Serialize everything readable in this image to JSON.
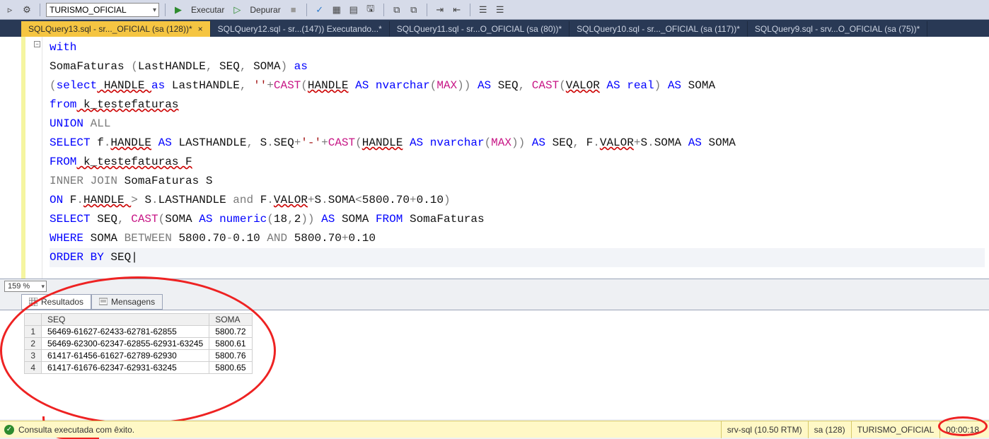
{
  "toolbar": {
    "combo_db": "TURISMO_OFICIAL",
    "execute_label": "Executar",
    "debug_label": "Depurar"
  },
  "tabs": [
    {
      "label": "SQLQuery13.sql - sr..._OFICIAL (sa (128))*",
      "active": true
    },
    {
      "label": "SQLQuery12.sql - sr...(147)) Executando...*",
      "active": false
    },
    {
      "label": "SQLQuery11.sql - sr...O_OFICIAL (sa (80))*",
      "active": false
    },
    {
      "label": "SQLQuery10.sql - sr..._OFICIAL (sa (117))*",
      "active": false
    },
    {
      "label": "SQLQuery9.sql - srv...O_OFICIAL (sa (75))*",
      "active": false
    }
  ],
  "code": {
    "l1": "with",
    "l2a": "SomaFaturas ",
    "l2b": "(",
    "l2c": "LastHANDLE",
    "l2d": ", ",
    "l2e": "SEQ",
    "l2f": ", ",
    "l2g": "SOMA",
    "l2h": ") ",
    "l2i": "as",
    "l3a": "(",
    "l3b": "select",
    "l3c": " HANDLE ",
    "l3d": "as",
    "l3e": " LastHANDLE",
    "l3f": ", ",
    "l3g": "''",
    "l3h": "+",
    "l3i": "CAST",
    "l3j": "(",
    "l3k": "HANDLE",
    "l3l": " AS ",
    "l3m": "nvarchar",
    "l3n": "(",
    "l3o": "MAX",
    "l3p": ")) ",
    "l3q": "AS ",
    "l3r": "SEQ",
    "l3s": ", ",
    "l3t": "CAST",
    "l3u": "(",
    "l3v": "VALOR",
    "l3w": " AS ",
    "l3x": "real",
    "l3y": ") ",
    "l3z": "AS ",
    "l3aa": "SOMA",
    "l4a": "from",
    "l4b": " k_testefaturas",
    "l5a": "UNION ",
    "l5b": "ALL",
    "l6a": "SELECT",
    "l6b": " f",
    "l6c": ".",
    "l6d": "HANDLE",
    "l6e": " AS ",
    "l6f": "LASTHANDLE",
    "l6g": ", ",
    "l6h": "S",
    "l6i": ".",
    "l6j": "SEQ",
    "l6k": "+",
    "l6l": "'-'",
    "l6m": "+",
    "l6n": "CAST",
    "l6o": "(",
    "l6p": "HANDLE",
    "l6q": " AS ",
    "l6r": "nvarchar",
    "l6s": "(",
    "l6t": "MAX",
    "l6u": ")) ",
    "l6v": "AS ",
    "l6w": "SEQ",
    "l6x": ", ",
    "l6y": "F",
    "l6z": ".",
    "l6aa": "VALOR",
    "l6ab": "+",
    "l6ac": "S",
    "l6ad": ".",
    "l6ae": "SOMA",
    "l6af": " AS ",
    "l6ag": "SOMA",
    "l7a": "FROM",
    "l7b": " k_testefaturas F",
    "l8a": "INNER",
    "l8b": " JOIN",
    "l8c": " SomaFaturas S",
    "l9a": "ON",
    "l9b": " F",
    "l9c": ".",
    "l9d": "HANDLE ",
    "l9e": ">",
    "l9f": " S",
    "l9g": ".",
    "l9h": "LASTHANDLE ",
    "l9i": "and",
    "l9j": " F",
    "l9k": ".",
    "l9l": "VALOR",
    "l9m": "+",
    "l9n": "S",
    "l9o": ".",
    "l9p": "SOMA",
    "l9q": "<",
    "l9r": "5800.70",
    "l9s": "+",
    "l9t": "0.10",
    "l9u": ")",
    "l10a": "SELECT",
    "l10b": " SEQ",
    "l10c": ", ",
    "l10d": "CAST",
    "l10e": "(",
    "l10f": "SOMA ",
    "l10g": "AS ",
    "l10h": "numeric",
    "l10i": "(",
    "l10j": "18",
    "l10k": ",",
    "l10l": "2",
    "l10m": ")) ",
    "l10n": "AS ",
    "l10o": "SOMA ",
    "l10p": "FROM",
    "l10q": " SomaFaturas",
    "l11a": "WHERE",
    "l11b": " SOMA ",
    "l11c": "BETWEEN",
    "l11d": " 5800.70",
    "l11e": "-",
    "l11f": "0.10 ",
    "l11g": "AND",
    "l11h": " 5800.70",
    "l11i": "+",
    "l11j": "0.10",
    "l12a": "ORDER",
    "l12b": " BY",
    "l12c": " SEQ"
  },
  "zoom": "159 %",
  "panel_tabs": {
    "results": "Resultados",
    "messages": "Mensagens"
  },
  "grid": {
    "headers": [
      "SEQ",
      "SOMA"
    ],
    "rows": [
      {
        "n": "1",
        "seq": "56469-61627-62433-62781-62855",
        "soma": "5800.72"
      },
      {
        "n": "2",
        "seq": "56469-62300-62347-62855-62931-63245",
        "soma": "5800.61"
      },
      {
        "n": "3",
        "seq": "61417-61456-61627-62789-62930",
        "soma": "5800.76"
      },
      {
        "n": "4",
        "seq": "61417-61676-62347-62931-63245",
        "soma": "5800.65"
      }
    ]
  },
  "status": {
    "message": "Consulta executada com êxito.",
    "server": "srv-sql (10.50 RTM)",
    "login": "sa (128)",
    "db": "TURISMO_OFICIAL",
    "elapsed": "00:00:18"
  }
}
